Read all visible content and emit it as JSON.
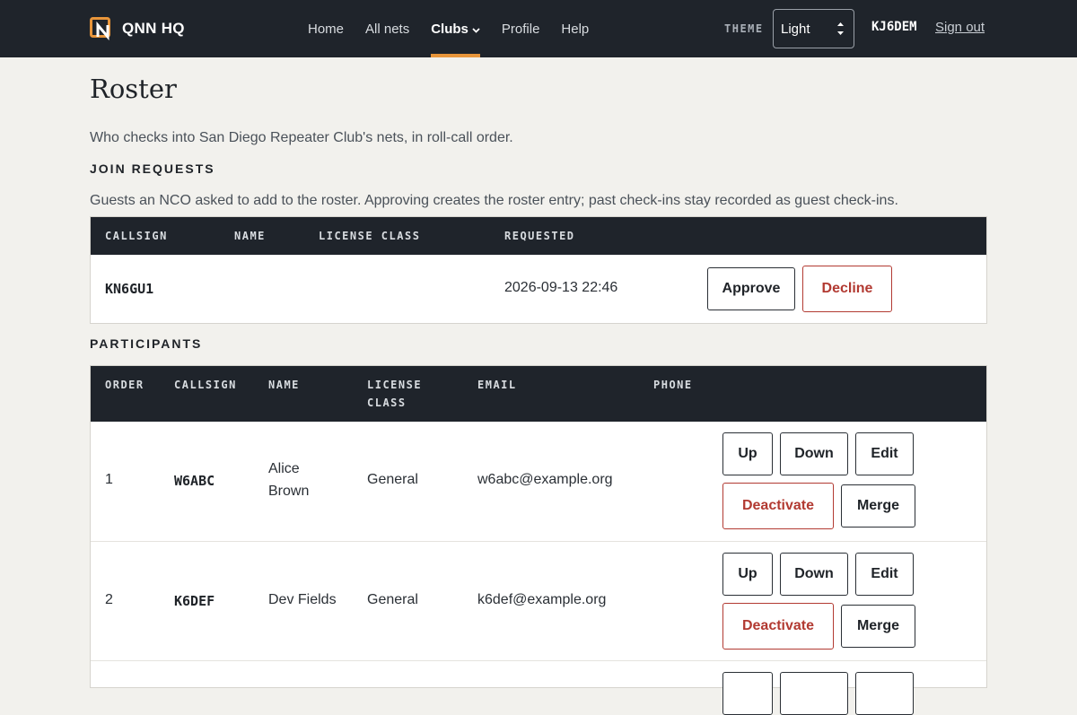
{
  "header": {
    "brand": "QNN HQ",
    "nav": [
      "Home",
      "All nets",
      "Clubs",
      "Profile",
      "Help"
    ],
    "theme_label": "THEME",
    "theme_value": "Light",
    "theme_options": [
      "Light"
    ],
    "user_callsign": "KJ6DEM",
    "signout": "Sign out",
    "colors": {
      "bar": "#1f242b",
      "accent": "#e8953a"
    }
  },
  "page": {
    "title": "Roster",
    "intro": "Who checks into San Diego Repeater Club's nets, in roll-call order."
  },
  "join_requests": {
    "heading": "JOIN REQUESTS",
    "note": "Guests an NCO asked to add to the roster. Approving creates the roster entry; past check-ins stay recorded as guest check-ins.",
    "columns": [
      "CALLSIGN",
      "NAME",
      "LICENSE CLASS",
      "REQUESTED"
    ],
    "rows": [
      {
        "callsign": "KN6GU1",
        "name": "",
        "license_class": "",
        "requested": "2026-09-13 22:46",
        "approve": "Approve",
        "decline": "Decline"
      }
    ]
  },
  "participants": {
    "heading": "PARTICIPANTS",
    "columns": [
      "ORDER",
      "CALLSIGN",
      "NAME",
      "LICENSE CLASS",
      "EMAIL",
      "PHONE"
    ],
    "rows": [
      {
        "order": "1",
        "callsign": "W6ABC",
        "name": "Alice Brown",
        "license_class": "General",
        "email": "w6abc@example.org",
        "phone": ""
      },
      {
        "order": "2",
        "callsign": "K6DEF",
        "name": "Dev Fields",
        "license_class": "General",
        "email": "k6def@example.org",
        "phone": ""
      }
    ],
    "actions": {
      "up": "Up",
      "down": "Down",
      "edit": "Edit",
      "deactivate": "Deactivate",
      "merge": "Merge"
    },
    "colors": {
      "danger": "#b23a32"
    }
  }
}
